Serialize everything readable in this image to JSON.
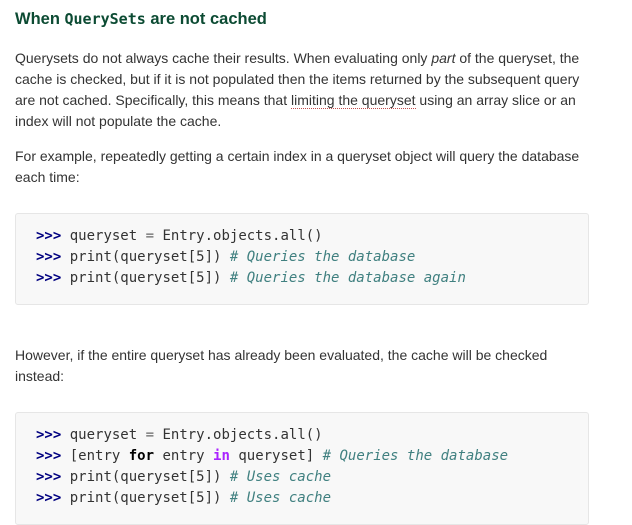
{
  "heading": {
    "prefix": "When ",
    "code": "QuerySets",
    "suffix": " are not cached"
  },
  "para1": {
    "t1": "Querysets do not always cache their results. When evaluating only ",
    "em": "part",
    "t2": " of the queryset, the cache is checked, but if it is not populated then the items returned by the subsequent query are not cached. Specifically, this means that ",
    "link": "limiting the queryset",
    "t3": " using an array slice or an index will not populate the cache."
  },
  "para2": "For example, repeatedly getting a certain index in a queryset object will query the database each time:",
  "code1": {
    "l1_prompt": ">>>",
    "l1_a": " queryset ",
    "l1_eq": "=",
    "l1_b": " Entry.objects.all()",
    "l2_prompt": ">>>",
    "l2_code": " print(queryset[5]) ",
    "l2_comment": "# Queries the database",
    "l3_prompt": ">>>",
    "l3_code": " print(queryset[5]) ",
    "l3_comment": "# Queries the database again"
  },
  "para3": "However, if the entire queryset has already been evaluated, the cache will be checked instead:",
  "code2": {
    "l1_prompt": ">>>",
    "l1_a": " queryset ",
    "l1_eq": "=",
    "l1_b": " Entry.objects.all()",
    "l2_prompt": ">>>",
    "l2_a": " [entry ",
    "l2_for": "for",
    "l2_b": " entry ",
    "l2_in": "in",
    "l2_c": " queryset] ",
    "l2_comment": "# Queries the database",
    "l3_prompt": ">>>",
    "l3_code": " print(queryset[5]) ",
    "l3_comment": "# Uses cache",
    "l4_prompt": ">>>",
    "l4_code": " print(queryset[5]) ",
    "l4_comment": "# Uses cache"
  },
  "colors": {
    "heading": "#0c4b33",
    "text": "#333333",
    "code_bg": "#f8f8f8",
    "prompt": "#000080",
    "comment": "#408080",
    "keyword_in": "#aa22ff"
  }
}
